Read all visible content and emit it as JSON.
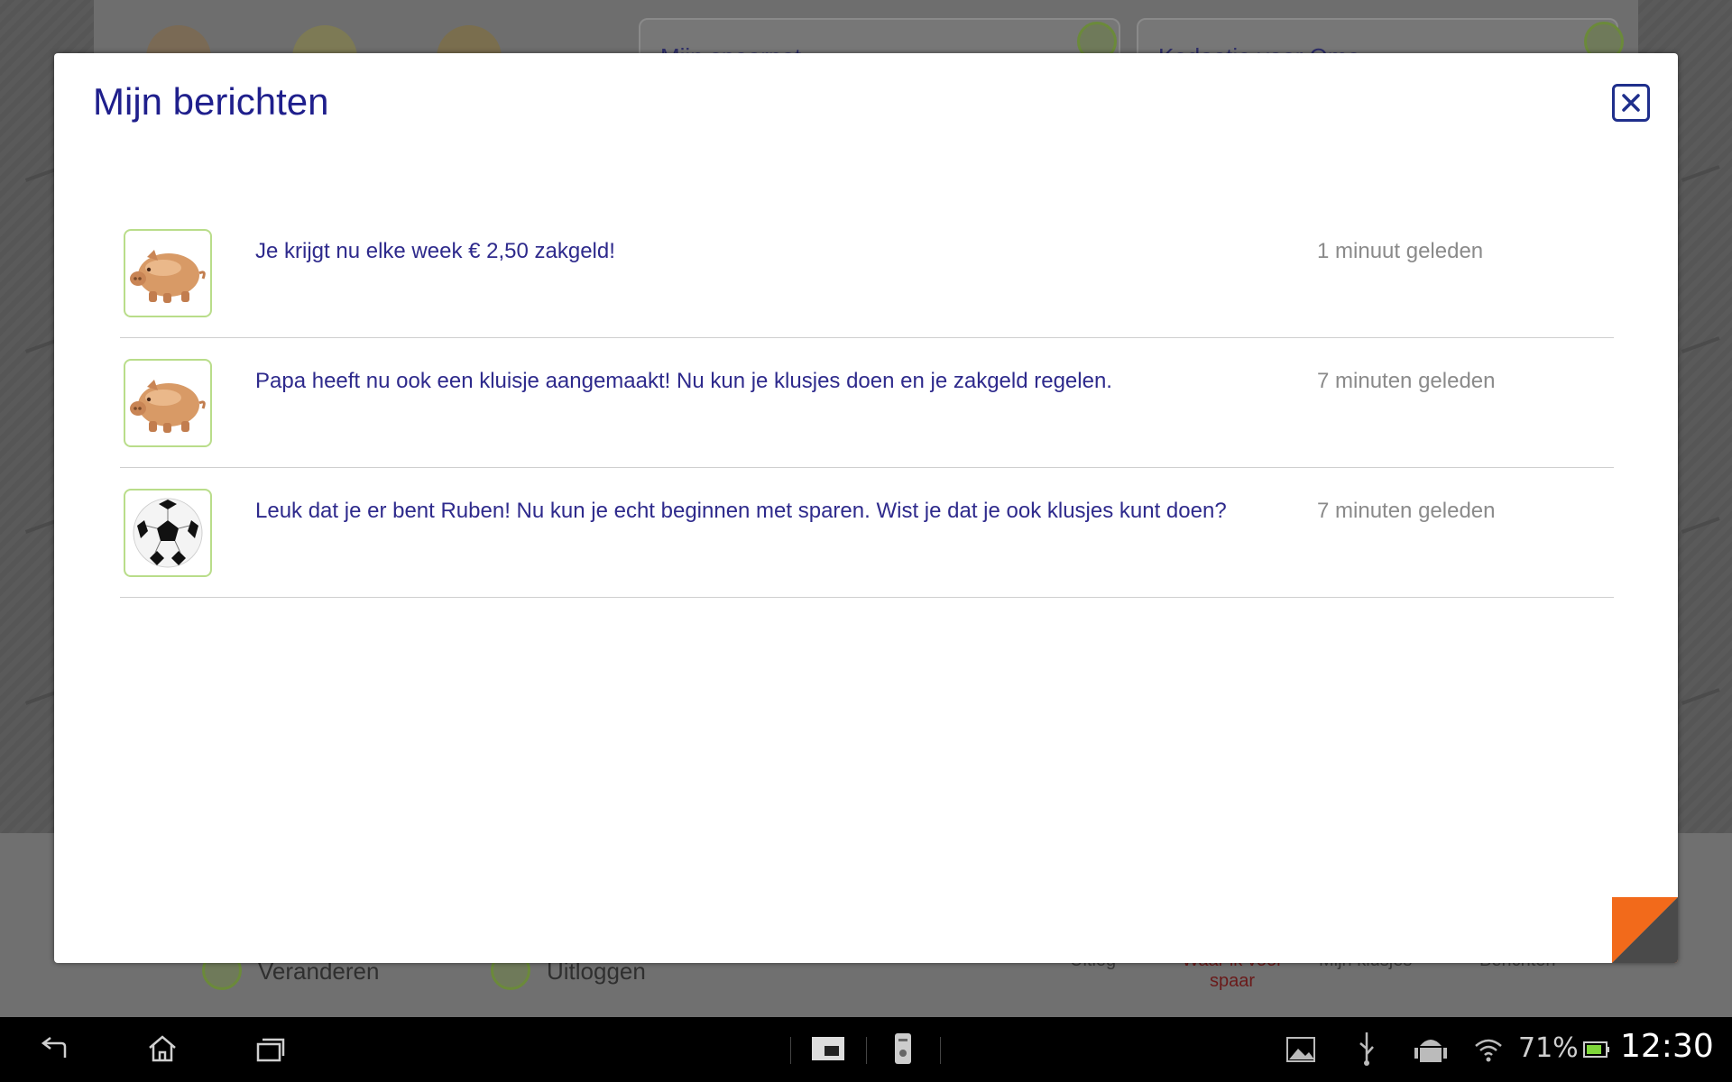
{
  "background": {
    "card_left_text": "Mijn spaarpot",
    "card_right_text": "Kadootje voor Oma",
    "footer_change": "Veranderen",
    "footer_logout": "Uitloggen",
    "nav_items": [
      "Uitleg",
      "Waar ik voor spaar",
      "Mijn klusjes",
      "Berichten"
    ]
  },
  "modal": {
    "title": "Mijn berichten",
    "close_icon": "close-icon"
  },
  "messages": [
    {
      "icon": "piggy-bank-icon",
      "text": "Je krijgt nu elke week € 2,50 zakgeld!",
      "time": "1 minuut geleden"
    },
    {
      "icon": "piggy-bank-icon",
      "text": "Papa heeft nu ook een kluisje aangemaakt! Nu kun je klusjes doen en je zakgeld regelen.",
      "time": "7 minuten geleden"
    },
    {
      "icon": "soccer-ball-icon",
      "text": "Leuk dat je er bent Ruben! Nu kun je echt beginnen met sparen. Wist je dat je ook klusjes kunt doen?",
      "time": "7 minuten geleden"
    }
  ],
  "statusbar": {
    "battery_percent": "71%",
    "time": "12:30"
  },
  "colors": {
    "title": "#1f1f8c",
    "message_text": "#2e2a8c",
    "timestamp": "#8a8a8a",
    "avatar_border": "#b9dd8a",
    "corner_accent": "#f26a1b"
  }
}
